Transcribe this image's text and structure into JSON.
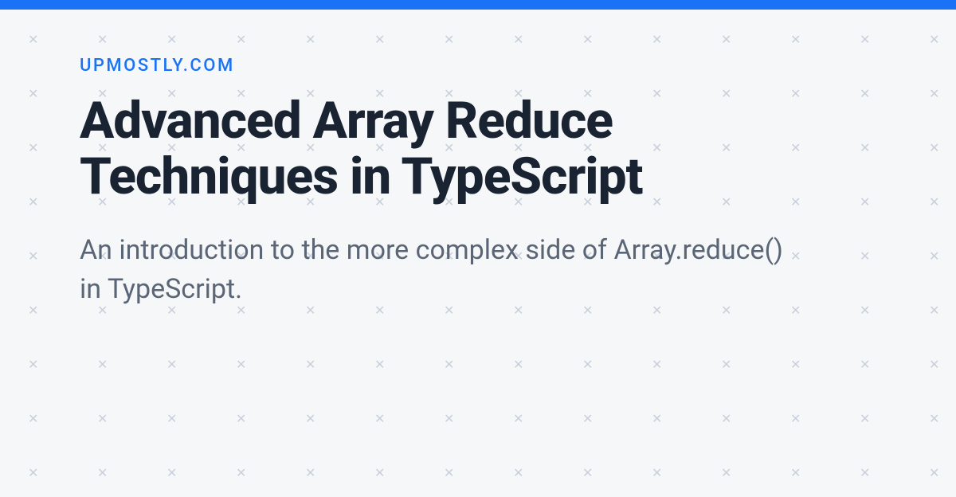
{
  "header": {
    "site_name": "UPMOSTLY.COM"
  },
  "article": {
    "title": "Advanced Array Reduce Techniques in TypeScript",
    "subtitle": "An introduction to the more complex side of Array.reduce() in TypeScript."
  },
  "colors": {
    "accent": "#1a73f7",
    "text_dark": "#1a2332",
    "text_muted": "#5a6576",
    "bg": "#f6f7f9",
    "pattern": "#c8d0db"
  }
}
